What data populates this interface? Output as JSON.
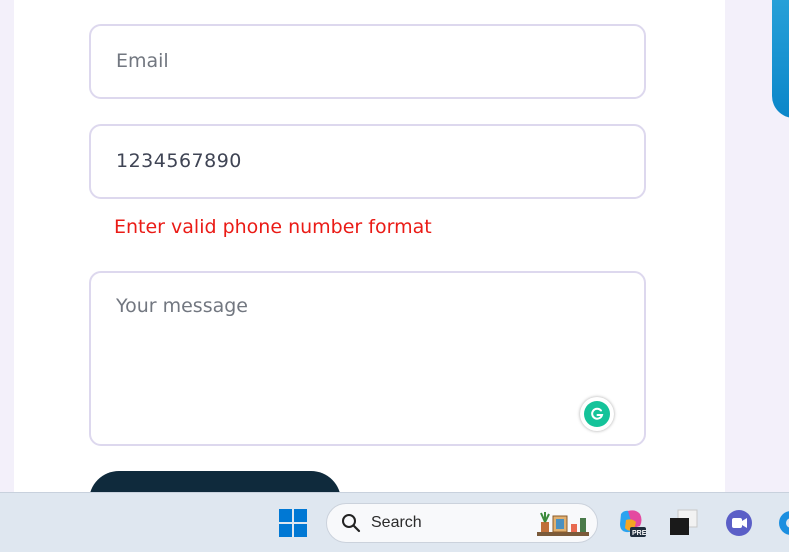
{
  "form": {
    "email_placeholder": "Email",
    "phone_value": "1234567890",
    "phone_error": "Enter valid phone number format",
    "message_placeholder": "Your message"
  },
  "taskbar": {
    "search_label": "Search"
  },
  "colors": {
    "error": "#ea1b16",
    "field_border": "#ddd8ee",
    "button": "#0f2a3c",
    "grammarly": "#15c39a"
  }
}
